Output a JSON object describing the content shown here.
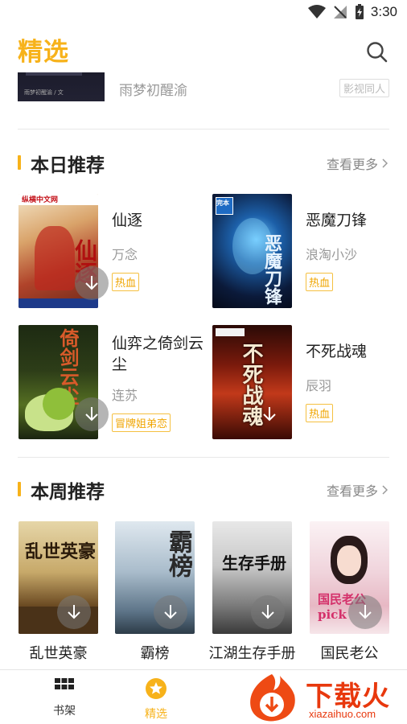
{
  "status_bar": {
    "time": "3:30"
  },
  "header": {
    "title": "精选"
  },
  "partial_item": {
    "cover_caption": "雨梦初醒渝 / 文",
    "title": "雨梦初醒渝",
    "tag": "影视同人"
  },
  "daily": {
    "title": "本日推荐",
    "more": "查看更多",
    "books": [
      {
        "title": "仙逐",
        "author": "万念",
        "tag": "热血",
        "cover_text": "仙逐",
        "cover_brand": "纵横中文网"
      },
      {
        "title": "恶魔刀锋",
        "author": "浪淘小沙",
        "tag": "热血",
        "cover_text": "恶魔刀锋",
        "cover_brand": "完本"
      },
      {
        "title": "仙弈之倚剑云尘",
        "author": "连苏",
        "tag": "冒牌姐弟恋",
        "cover_text": "倚剑云尘"
      },
      {
        "title": "不死战魂",
        "author": "辰羽",
        "tag": "热血",
        "cover_text": "不死战魂"
      }
    ]
  },
  "weekly": {
    "title": "本周推荐",
    "more": "查看更多",
    "books": [
      {
        "title": "乱世英豪",
        "cover_text": "乱世英豪"
      },
      {
        "title": "霸榜",
        "cover_text": "霸榜"
      },
      {
        "title": "江湖生存手册",
        "cover_text": "生存手册"
      },
      {
        "title": "国民老公",
        "cover_text": "国民老公pick"
      }
    ]
  },
  "bottom_nav": [
    {
      "label": "书架",
      "icon": "grid-icon"
    },
    {
      "label": "精选",
      "icon": "star-icon",
      "active": true
    }
  ],
  "watermark": {
    "text": "下载火",
    "sub": "xiazaihuo.com"
  },
  "colors": {
    "accent": "#f7b21a",
    "watermark": "#e8380d"
  }
}
